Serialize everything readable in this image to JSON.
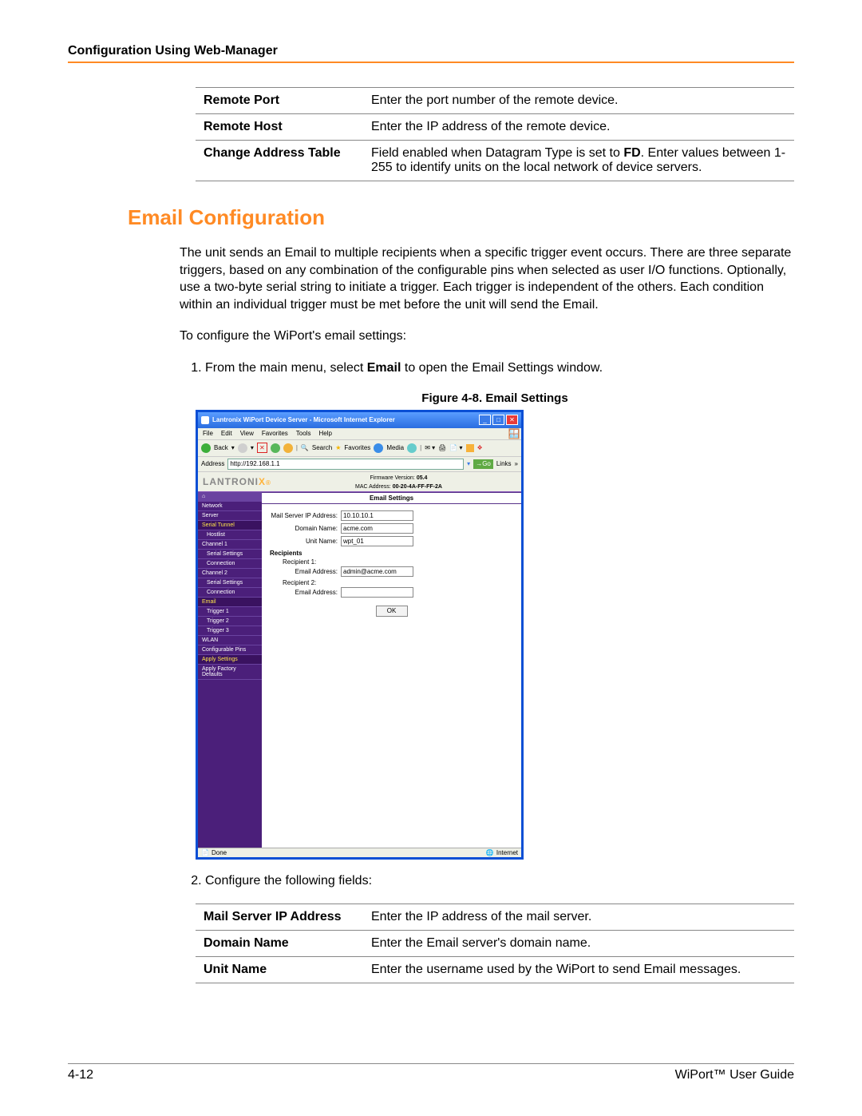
{
  "page": {
    "header_title": "Configuration Using Web-Manager",
    "section_title": "Email Configuration",
    "paragraph1": "The unit sends an Email to multiple recipients when a specific trigger event occurs. There are three separate triggers, based on any combination of the configurable pins when selected as user I/O functions. Optionally, use a two-byte serial string to initiate a trigger. Each trigger is independent of the others. Each condition within an individual trigger must be met before the unit will send the Email.",
    "paragraph2": "To configure the WiPort's email settings:",
    "step1_pre": "From the main menu, select ",
    "step1_bold": "Email",
    "step1_post": " to open the Email Settings window.",
    "step2": "Configure the following fields:",
    "figure_caption": "Figure 4-8. Email Settings",
    "footer_left": "4-12",
    "footer_right": "WiPort™ User Guide"
  },
  "table1": {
    "rows": [
      {
        "k": "Remote Port",
        "v": "Enter the port number of the remote device."
      },
      {
        "k": "Remote Host",
        "v": "Enter the IP address of the remote device."
      },
      {
        "k": "Change Address Table",
        "v_pre": "Field enabled when Datagram Type is set to ",
        "v_bold": "FD",
        "v_post": ".  Enter values between 1-255 to identify units on the local network of device servers."
      }
    ]
  },
  "table2": {
    "rows": [
      {
        "k": "Mail Server IP Address",
        "v": "Enter the IP address of the mail server."
      },
      {
        "k": "Domain Name",
        "v": "Enter the Email server's domain name."
      },
      {
        "k": "Unit Name",
        "v": "Enter the username used by the WiPort to send Email messages."
      }
    ]
  },
  "screenshot": {
    "window_title": "Lantronix WiPort Device Server - Microsoft Internet Explorer",
    "menus": [
      "File",
      "Edit",
      "View",
      "Favorites",
      "Tools",
      "Help"
    ],
    "tb_back": "Back",
    "tb_search": "Search",
    "tb_favorites": "Favorites",
    "tb_media": "Media",
    "addr_label": "Address",
    "addr_value": "http://192.168.1.1",
    "addr_go": "Go",
    "addr_links": "Links",
    "logo_text": "LANTRONI",
    "logo_last": "X",
    "firmware_label": "Firmware Version:",
    "firmware_value": "05.4",
    "mac_label": "MAC Address:",
    "mac_value": "00-20-4A-FF-FF-2A",
    "banner": "Email Settings",
    "sidebar": [
      {
        "label": "⌂",
        "cls": "home"
      },
      {
        "label": "Network",
        "cls": ""
      },
      {
        "label": "Server",
        "cls": ""
      },
      {
        "label": "Serial Tunnel",
        "cls": "sel"
      },
      {
        "label": "Hostlist",
        "cls": "l2"
      },
      {
        "label": "Channel 1",
        "cls": ""
      },
      {
        "label": "Serial Settings",
        "cls": "l2"
      },
      {
        "label": "Connection",
        "cls": "l2"
      },
      {
        "label": "Channel 2",
        "cls": ""
      },
      {
        "label": "Serial Settings",
        "cls": "l2"
      },
      {
        "label": "Connection",
        "cls": "l2"
      },
      {
        "label": "Email",
        "cls": "sel"
      },
      {
        "label": "Trigger 1",
        "cls": "l2"
      },
      {
        "label": "Trigger 2",
        "cls": "l2"
      },
      {
        "label": "Trigger 3",
        "cls": "l2"
      },
      {
        "label": "WLAN",
        "cls": ""
      },
      {
        "label": "Configurable Pins",
        "cls": ""
      },
      {
        "label": "Apply Settings",
        "cls": "sel"
      },
      {
        "label": "Apply Factory Defaults",
        "cls": ""
      }
    ],
    "form": {
      "mail_ip_label": "Mail Server IP Address:",
      "mail_ip_value": "10.10.10.1",
      "domain_label": "Domain Name:",
      "domain_value": "acme.com",
      "unit_label": "Unit Name:",
      "unit_value": "wpt_01",
      "recipients": "Recipients",
      "r1": "Recipient 1:",
      "r1_email_label": "Email Address:",
      "r1_email_value": "admin@acme.com",
      "r2": "Recipient 2:",
      "r2_email_label": "Email Address:",
      "r2_email_value": "",
      "ok": "OK"
    },
    "status_done": "Done",
    "status_net": "Internet"
  }
}
